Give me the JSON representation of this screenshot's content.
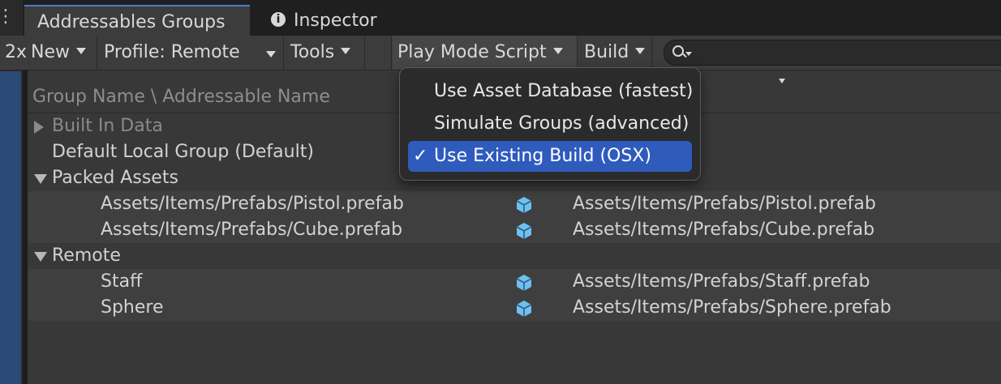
{
  "left_strip": {
    "glyph": "⋮"
  },
  "tabs": [
    {
      "label": "Addressables Groups"
    },
    {
      "label": "Inspector",
      "icon": "info-icon"
    }
  ],
  "toolbar": {
    "zoom": "2x",
    "new_label": "New",
    "profile_label": "Profile: Remote",
    "tools_label": "Tools",
    "play_mode_label": "Play Mode Script",
    "build_label": "Build",
    "search_placeholder": ""
  },
  "tree": {
    "header": "Group Name \\ Addressable Name",
    "rows": [
      {
        "label": "Built In Data"
      },
      {
        "label": "Default Local Group (Default)"
      },
      {
        "label": "Packed Assets"
      },
      {
        "label": "Assets/Items/Prefabs/Pistol.prefab",
        "path": "Assets/Items/Prefabs/Pistol.prefab"
      },
      {
        "label": "Assets/Items/Prefabs/Cube.prefab",
        "path": "Assets/Items/Prefabs/Cube.prefab"
      },
      {
        "label": "Remote"
      },
      {
        "label": "Staff",
        "path": "Assets/Items/Prefabs/Staff.prefab"
      },
      {
        "label": "Sphere",
        "path": "Assets/Items/Prefabs/Sphere.prefab"
      }
    ]
  },
  "dropdown": {
    "items": [
      {
        "label": "Use Asset Database (fastest)"
      },
      {
        "label": "Simulate Groups (advanced)"
      },
      {
        "label": "Use Existing Build (OSX)",
        "check": "✓"
      }
    ]
  },
  "colors": {
    "accent": "#2f5bbd",
    "cube": "#6ec0f0"
  }
}
